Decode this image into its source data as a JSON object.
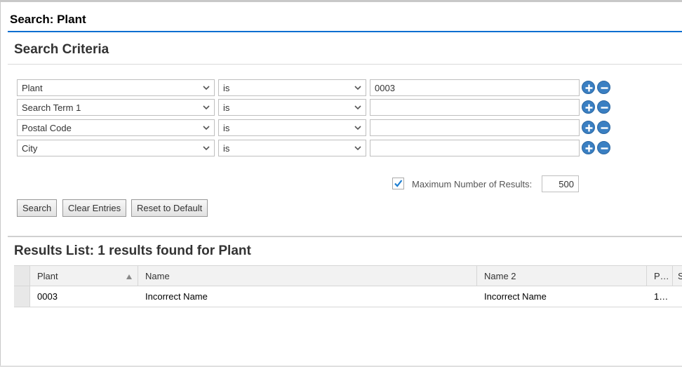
{
  "dialog": {
    "title": "Search: Plant"
  },
  "criteria": {
    "title": "Search Criteria",
    "rows": [
      {
        "field": "Plant",
        "operator": "is",
        "value": "0003"
      },
      {
        "field": "Search Term 1",
        "operator": "is",
        "value": ""
      },
      {
        "field": "Postal Code",
        "operator": "is",
        "value": ""
      },
      {
        "field": "City",
        "operator": "is",
        "value": ""
      }
    ],
    "max_results": {
      "checked": true,
      "label": "Maximum Number of Results:",
      "value": "500"
    },
    "buttons": {
      "search": "Search",
      "clear": "Clear Entries",
      "reset": "Reset to Default"
    }
  },
  "results": {
    "title": "Results List: 1 results found for Plant",
    "columns": [
      "Plant",
      "Name",
      "Name 2",
      "P…",
      "S"
    ],
    "rows": [
      {
        "plant": "0003",
        "name": "Incorrect Name",
        "name2": "Incorrect Name",
        "p": "1…"
      }
    ]
  },
  "colors": {
    "accent": "#0a6ed1",
    "icon_blue": "#3a7fc2"
  },
  "icons": {
    "dropdown": "chevron-down-icon",
    "add": "plus-circle-icon",
    "remove": "minus-circle-icon",
    "sort": "sort-ascending-icon",
    "check": "checkmark-icon"
  }
}
